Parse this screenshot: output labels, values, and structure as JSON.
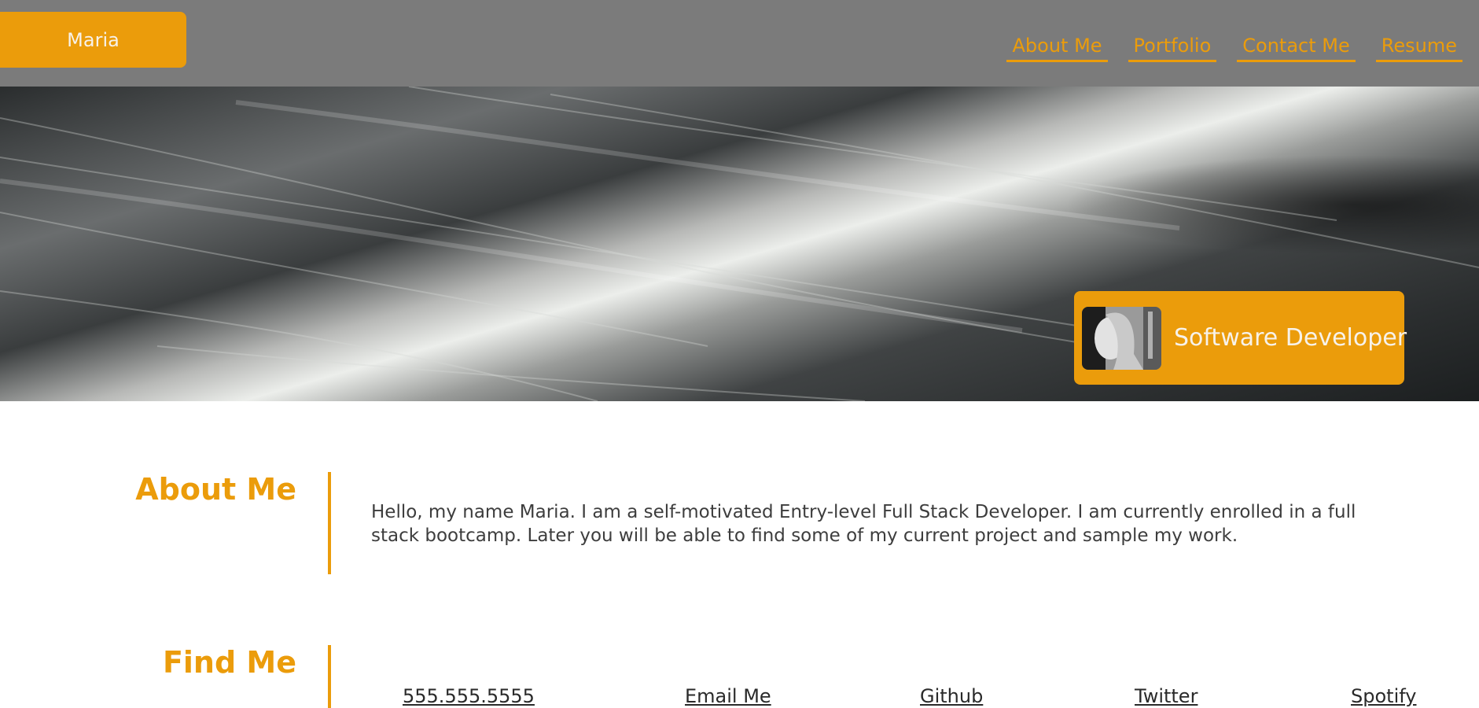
{
  "header": {
    "logo_label": "Maria",
    "nav": [
      {
        "label": "About Me"
      },
      {
        "label": "Portfolio"
      },
      {
        "label": "Contact Me"
      },
      {
        "label": "Resume"
      }
    ]
  },
  "hero": {
    "badge_title": "Software Developer"
  },
  "about": {
    "heading": "About Me",
    "text": "Hello, my name Maria. I am a self-motivated Entry-level Full Stack Developer. I am currently enrolled in a full stack bootcamp. Later you will be able to find some of my current project and sample my work."
  },
  "find_me": {
    "heading": "Find Me",
    "links": [
      {
        "label": "555.555.5555"
      },
      {
        "label": "Email Me"
      },
      {
        "label": "Github"
      },
      {
        "label": "Twitter"
      },
      {
        "label": "Spotify"
      }
    ]
  },
  "colors": {
    "accent": "#eb9c0b",
    "header_bg": "#7b7b7b",
    "text": "#3d3d3d"
  }
}
